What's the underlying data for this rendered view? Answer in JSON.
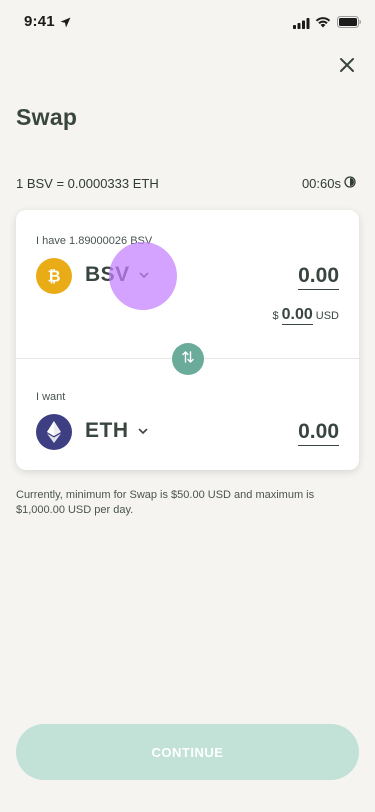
{
  "status_bar": {
    "time": "9:41",
    "icons": [
      "location-arrow-icon",
      "cellular-signal-icon",
      "wifi-icon",
      "battery-icon"
    ]
  },
  "header": {
    "title": "Swap",
    "close_icon": "close-icon"
  },
  "rate": {
    "text": "1 BSV = 0.0000333 ETH",
    "timer": "00:60s",
    "timer_icon": "countdown-timer-icon"
  },
  "from": {
    "label": "I have 1.89000026 BSV",
    "coin": "BSV",
    "coin_icon": "bitcoin-sv-icon",
    "coin_color": "#e9ac16",
    "amount": "0.00",
    "usd_prefix": "$",
    "usd_amount": "0.00",
    "usd_unit": "USD"
  },
  "to": {
    "label": "I want",
    "coin": "ETH",
    "coin_icon": "ethereum-icon",
    "coin_color": "#3e3f82",
    "amount": "0.00"
  },
  "swap_icon": "swap-direction-icon",
  "note": "Currently, minimum for Swap is $50.00 USD and maximum is $1,000.00 USD per day.",
  "continue_label": "CONTINUE",
  "colors": {
    "accent": "#6aab99",
    "button_disabled": "#c2e2d8",
    "background": "#f5f4f0",
    "text": "#39463f"
  }
}
